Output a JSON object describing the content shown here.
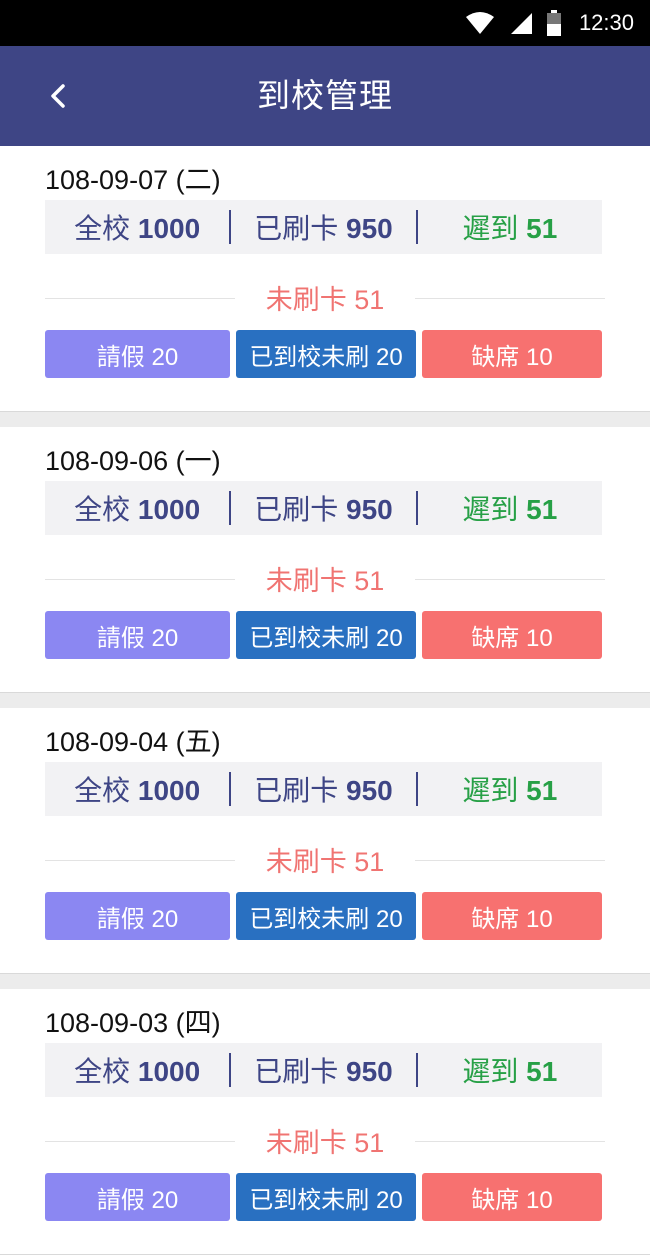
{
  "status": {
    "time": "12:30",
    "icons": [
      "wifi-icon",
      "signal-icon",
      "battery-icon"
    ]
  },
  "appbar": {
    "title": "到校管理",
    "back_icon": "chevron-left-icon"
  },
  "colors": {
    "appbar": "#3e4585",
    "late": "#27a046",
    "unswiped": "#f07472",
    "leave": "#8b87f2",
    "arrived": "#2970c1",
    "absent": "#f77170"
  },
  "records": [
    {
      "date": "108-09-07 (二)",
      "total_label": "全校",
      "total": "1000",
      "swiped_label": "已刷卡",
      "swiped": "950",
      "late_label": "遲到",
      "late": "51",
      "unswiped": "未刷卡 51",
      "leave": "請假 20",
      "arrived_unswiped": "已到校未刷 20",
      "absent": "缺席 10"
    },
    {
      "date": "108-09-06 (一)",
      "total_label": "全校",
      "total": "1000",
      "swiped_label": "已刷卡",
      "swiped": "950",
      "late_label": "遲到",
      "late": "51",
      "unswiped": "未刷卡 51",
      "leave": "請假 20",
      "arrived_unswiped": "已到校未刷 20",
      "absent": "缺席 10"
    },
    {
      "date": "108-09-04 (五)",
      "total_label": "全校",
      "total": "1000",
      "swiped_label": "已刷卡",
      "swiped": "950",
      "late_label": "遲到",
      "late": "51",
      "unswiped": "未刷卡 51",
      "leave": "請假 20",
      "arrived_unswiped": "已到校未刷 20",
      "absent": "缺席 10"
    },
    {
      "date": "108-09-03 (四)",
      "total_label": "全校",
      "total": "1000",
      "swiped_label": "已刷卡",
      "swiped": "950",
      "late_label": "遲到",
      "late": "51",
      "unswiped": "未刷卡 51",
      "leave": "請假 20",
      "arrived_unswiped": "已到校未刷 20",
      "absent": "缺席 10"
    }
  ]
}
